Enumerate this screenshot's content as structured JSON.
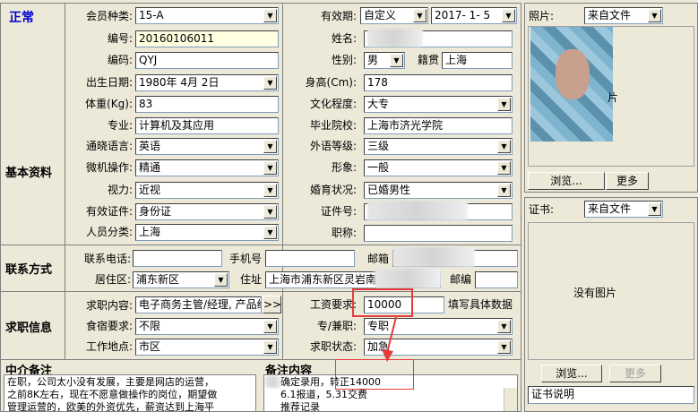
{
  "status": "正常",
  "basic": {
    "section_title": "基本资料",
    "member_type_label": "会员种类:",
    "member_type_value": "15-A",
    "validity_label": "有效期:",
    "validity_mode": "自定义",
    "validity_date": "2017- 1- 5",
    "number_label": "编号:",
    "number_value": "20160106011",
    "name_label": "姓名:",
    "name_value": "",
    "code_label": "编码:",
    "code_value": "QYJ",
    "gender_label": "性别:",
    "gender_value": "男",
    "native_label": "籍贯",
    "native_value": "上海",
    "birth_label": "出生日期:",
    "birth_value": "1980年 4月 2日",
    "height_label": "身高(Cm):",
    "height_value": "178",
    "weight_label": "体重(Kg):",
    "weight_value": "83",
    "education_label": "文化程度:",
    "education_value": "大专",
    "major_label": "专业:",
    "major_value": "计算机及其应用",
    "school_label": "毕业院校:",
    "school_value": "上海市济光学院",
    "language_label": "通晓语言:",
    "language_value": "英语",
    "foreign_level_label": "外语等级:",
    "foreign_level_value": "三级",
    "computer_label": "微机操作:",
    "computer_value": "精通",
    "image_label": "形象:",
    "image_value": "一般",
    "vision_label": "视力:",
    "vision_value": "近视",
    "marital_label": "婚育状况:",
    "marital_value": "已婚男性",
    "id_type_label": "有效证件:",
    "id_type_value": "身份证",
    "id_no_label": "证件号:",
    "id_no_value": "",
    "category_label": "人员分类:",
    "category_value": "上海",
    "title_label": "职称:",
    "title_value": ""
  },
  "contact": {
    "section_title": "联系方式",
    "phone_label": "联系电话:",
    "phone_value": "",
    "mobile_label": "手机号",
    "mobile_value": "",
    "email_label": "邮箱",
    "email_value": "",
    "district_label": "居住区:",
    "district_value": "浦东新区",
    "address_label": "住址",
    "address_value": "上海市浦东新区灵岩南路",
    "postcode_label": "邮编",
    "postcode_value": ""
  },
  "job": {
    "section_title": "求职信息",
    "content_label": "求职内容:",
    "content_value": "电子商务主管/经理, 产品经",
    "more_btn": ">>",
    "salary_label": "工资要求:",
    "salary_value": "10000",
    "salary_hint": "填写具体数据",
    "meal_label": "食宿要求:",
    "meal_value": "不限",
    "parttime_label": "专/兼职:",
    "parttime_value": "专职",
    "location_label": "工作地点:",
    "location_value": "市区",
    "state_label": "求职状态:",
    "state_value": "加急"
  },
  "agency_note": {
    "title": "中介备注",
    "lines": [
      "在职，公司太小没有发展，主要是网店的运营，",
      "之前8K左右，现在不愿意做操作的岗位，期望做",
      "管理运营的，欧美的外资优先，薪资达到上海平"
    ]
  },
  "remark": {
    "title": "备注内容",
    "lines": [
      "确定录用，转正14000",
      "6.1报道，5.31交费",
      "推荐记录"
    ]
  },
  "photo": {
    "label": "照片:",
    "source": "来自文件",
    "browse_btn": "浏览...",
    "more_btn": "更多",
    "partial_text": "片"
  },
  "certificate": {
    "label": "证书:",
    "source": "来自文件",
    "no_image": "没有图片",
    "browse_btn": "浏览...",
    "more_btn": "更多",
    "desc_label": "证书说明"
  },
  "colors": {
    "window_bg": "#ece9d8",
    "highlight_red": "#e53b3b",
    "status_blue": "#0000cc",
    "number_field_bg": "#ffffe1"
  }
}
